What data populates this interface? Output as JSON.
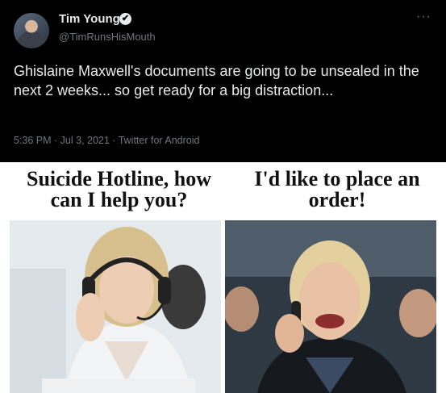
{
  "tweet": {
    "display_name": "Tim Young",
    "handle": "@TimRunsHisMouth",
    "text": "Ghislaine Maxwell's documents are going to be unsealed in the next 2 weeks... so get ready for a big distraction...",
    "timestamp": "5:36 PM · Jul 3, 2021 · Twitter for Android",
    "more_icon": "···",
    "verified_icon": "✔"
  },
  "meme": {
    "left_caption": "Suicide Hotline, how can I help you?",
    "right_caption": "I'd like to place an order!"
  }
}
